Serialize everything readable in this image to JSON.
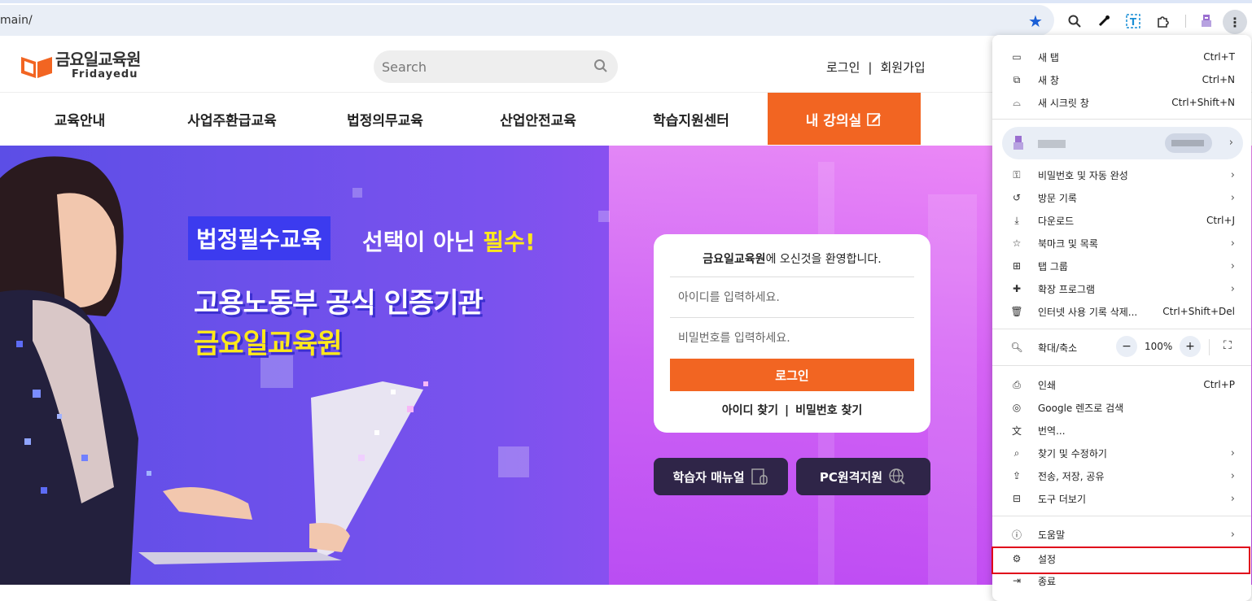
{
  "browser": {
    "url": "main/",
    "menu": {
      "new_tab": {
        "label": "새 탭",
        "shortcut": "Ctrl+T"
      },
      "new_window": {
        "label": "새 창",
        "shortcut": "Ctrl+N"
      },
      "incognito": {
        "label": "새 시크릿 창",
        "shortcut": "Ctrl+Shift+N"
      },
      "passwords": {
        "label": "비밀번호 및 자동 완성"
      },
      "history": {
        "label": "방문 기록"
      },
      "downloads": {
        "label": "다운로드",
        "shortcut": "Ctrl+J"
      },
      "bookmarks": {
        "label": "북마크 및 목록"
      },
      "tab_groups": {
        "label": "탭 그룹"
      },
      "extensions": {
        "label": "확장 프로그램"
      },
      "clear_data": {
        "label": "인터넷 사용 기록 삭제...",
        "shortcut": "Ctrl+Shift+Del"
      },
      "zoom": {
        "label": "확대/축소",
        "value": "100%",
        "minus": "−",
        "plus": "+"
      },
      "print": {
        "label": "인쇄",
        "shortcut": "Ctrl+P"
      },
      "lens": {
        "label": "Google 렌즈로 검색"
      },
      "translate": {
        "label": "번역..."
      },
      "find": {
        "label": "찾기 및 수정하기"
      },
      "cast": {
        "label": "전송, 저장, 공유"
      },
      "more_tools": {
        "label": "도구 더보기"
      },
      "help": {
        "label": "도움말"
      },
      "settings": {
        "label": "설정"
      },
      "exit": {
        "label": "종료"
      }
    }
  },
  "site": {
    "logo_ko": "금요일교육원",
    "logo_en": "Fridayedu",
    "search_placeholder": "Search",
    "login": "로그인",
    "signup": "회원가입",
    "link_sep": "|",
    "nav": [
      "교육안내",
      "사업주환급교육",
      "법정의무교육",
      "산업안전교육",
      "학습지원센터"
    ],
    "nav_cta": "내 강의실",
    "hero": {
      "tag": "법정필수교육",
      "tag_text": "선택이 아닌 ",
      "tag_highlight": "필수!",
      "title1": "고용노동부 공식 인증기관",
      "title2": "금요일교육원"
    },
    "loginbox": {
      "welcome_bold": "금요일교육원",
      "welcome_rest": "에 오신것을 환영합니다.",
      "id_placeholder": "아이디를 입력하세요.",
      "pw_placeholder": "비밀번호를 입력하세요.",
      "login_button": "로그인",
      "find_id": "아이디 찾기",
      "find_pw": "비밀번호 찾기"
    },
    "manual_button": "학습자 매뉴얼",
    "remote_button": "PC원격지원"
  }
}
